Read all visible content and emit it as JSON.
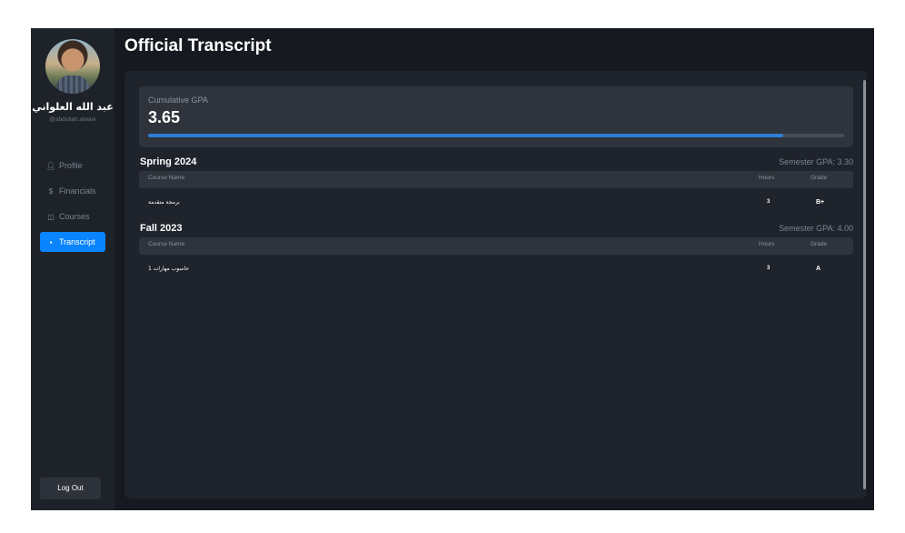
{
  "page": {
    "title": "Official Transcript"
  },
  "user": {
    "name": "عبد الله العلواني",
    "handle": "@abdullah.alwani"
  },
  "sidebar": {
    "items": [
      {
        "label": "Profile",
        "icon": "person-icon",
        "active": false
      },
      {
        "label": "Financials",
        "icon": "dollar-icon",
        "active": false
      },
      {
        "label": "Courses",
        "icon": "book-icon",
        "active": false
      },
      {
        "label": "Transcript",
        "icon": "document-icon",
        "active": true
      }
    ],
    "logout_label": "Log Out"
  },
  "gpa": {
    "label": "Cumulative GPA",
    "value": "3.65",
    "progress_fraction": 0.9125
  },
  "table_headers": {
    "course": "Course Name",
    "hours": "Hours",
    "grade": "Grade"
  },
  "semesters": [
    {
      "title": "Spring 2024",
      "gpa_text": "Semester GPA: 3.30",
      "courses": [
        {
          "name": "برمجة متقدمة",
          "hours": "3",
          "grade": "B+"
        }
      ]
    },
    {
      "title": "Fall 2023",
      "gpa_text": "Semester GPA: 4.00",
      "courses": [
        {
          "name": "حاسوب مهارات 1",
          "hours": "3",
          "grade": "A"
        }
      ]
    }
  ],
  "colors": {
    "accent": "#0a84ff",
    "progress": "#2e7fd3",
    "background": "#16191f"
  }
}
